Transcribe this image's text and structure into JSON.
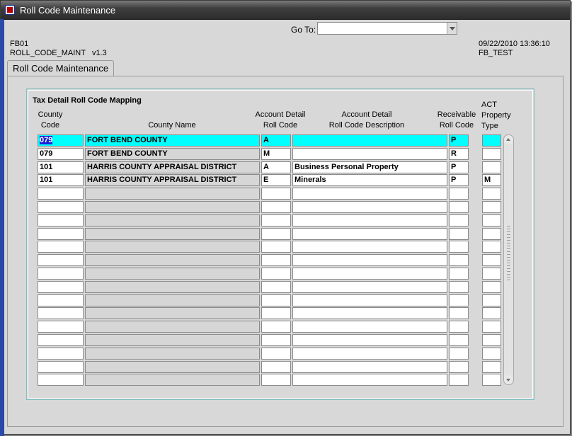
{
  "window": {
    "title": "Roll Code Maintenance"
  },
  "toolbar": {
    "goto_label": "Go To:",
    "goto_value": ""
  },
  "info": {
    "form_id": "FB01",
    "module": "ROLL_CODE_MAINT   v1.3",
    "datetime": "09/22/2010 13:36:10",
    "user": "FB_TEST"
  },
  "tab": {
    "label": "Roll Code Maintenance"
  },
  "block": {
    "title": "Tax Detail Roll Code Mapping",
    "headers": {
      "county_code": [
        "County",
        "Code"
      ],
      "county_name": [
        "County Name"
      ],
      "acct_roll_code": [
        "Account Detail",
        "Roll Code"
      ],
      "acct_roll_desc": [
        "Account Detail",
        "Roll Code Description"
      ],
      "recv_roll_code": [
        "Receivable",
        "Roll Code"
      ],
      "act_prop_type": [
        "ACT",
        "Property",
        "Type"
      ]
    }
  },
  "rows": [
    {
      "county_code": "079",
      "county_name": "FORT BEND COUNTY",
      "acct_roll_code": "A",
      "acct_roll_desc": "",
      "recv_roll_code": "P",
      "act_prop_type": ""
    },
    {
      "county_code": "079",
      "county_name": "FORT BEND COUNTY",
      "acct_roll_code": "M",
      "acct_roll_desc": "",
      "recv_roll_code": "R",
      "act_prop_type": ""
    },
    {
      "county_code": "101",
      "county_name": "HARRIS COUNTY APPRAISAL DISTRICT",
      "acct_roll_code": "A",
      "acct_roll_desc": "Business Personal Property",
      "recv_roll_code": "P",
      "act_prop_type": ""
    },
    {
      "county_code": "101",
      "county_name": "HARRIS COUNTY APPRAISAL DISTRICT",
      "acct_roll_code": "E",
      "acct_roll_desc": "Minerals",
      "recv_roll_code": "P",
      "act_prop_type": "M"
    },
    {
      "county_code": "",
      "county_name": "",
      "acct_roll_code": "",
      "acct_roll_desc": "",
      "recv_roll_code": "",
      "act_prop_type": ""
    },
    {
      "county_code": "",
      "county_name": "",
      "acct_roll_code": "",
      "acct_roll_desc": "",
      "recv_roll_code": "",
      "act_prop_type": ""
    },
    {
      "county_code": "",
      "county_name": "",
      "acct_roll_code": "",
      "acct_roll_desc": "",
      "recv_roll_code": "",
      "act_prop_type": ""
    },
    {
      "county_code": "",
      "county_name": "",
      "acct_roll_code": "",
      "acct_roll_desc": "",
      "recv_roll_code": "",
      "act_prop_type": ""
    },
    {
      "county_code": "",
      "county_name": "",
      "acct_roll_code": "",
      "acct_roll_desc": "",
      "recv_roll_code": "",
      "act_prop_type": ""
    },
    {
      "county_code": "",
      "county_name": "",
      "acct_roll_code": "",
      "acct_roll_desc": "",
      "recv_roll_code": "",
      "act_prop_type": ""
    },
    {
      "county_code": "",
      "county_name": "",
      "acct_roll_code": "",
      "acct_roll_desc": "",
      "recv_roll_code": "",
      "act_prop_type": ""
    },
    {
      "county_code": "",
      "county_name": "",
      "acct_roll_code": "",
      "acct_roll_desc": "",
      "recv_roll_code": "",
      "act_prop_type": ""
    },
    {
      "county_code": "",
      "county_name": "",
      "acct_roll_code": "",
      "acct_roll_desc": "",
      "recv_roll_code": "",
      "act_prop_type": ""
    },
    {
      "county_code": "",
      "county_name": "",
      "acct_roll_code": "",
      "acct_roll_desc": "",
      "recv_roll_code": "",
      "act_prop_type": ""
    },
    {
      "county_code": "",
      "county_name": "",
      "acct_roll_code": "",
      "acct_roll_desc": "",
      "recv_roll_code": "",
      "act_prop_type": ""
    },
    {
      "county_code": "",
      "county_name": "",
      "acct_roll_code": "",
      "acct_roll_desc": "",
      "recv_roll_code": "",
      "act_prop_type": ""
    },
    {
      "county_code": "",
      "county_name": "",
      "acct_roll_code": "",
      "acct_roll_desc": "",
      "recv_roll_code": "",
      "act_prop_type": ""
    },
    {
      "county_code": "",
      "county_name": "",
      "acct_roll_code": "",
      "acct_roll_desc": "",
      "recv_roll_code": "",
      "act_prop_type": ""
    },
    {
      "county_code": "",
      "county_name": "",
      "acct_roll_code": "",
      "acct_roll_desc": "",
      "recv_roll_code": "",
      "act_prop_type": ""
    }
  ],
  "colors": {
    "current_record": "#00ffff",
    "selection": "#1a24d6",
    "title_bar": "#3f3f3f"
  },
  "icons": {
    "window": "app-window-icon",
    "dropdown": "chevron-down-icon",
    "scroll_up": "arrow-up-icon",
    "scroll_down": "arrow-down-icon"
  }
}
